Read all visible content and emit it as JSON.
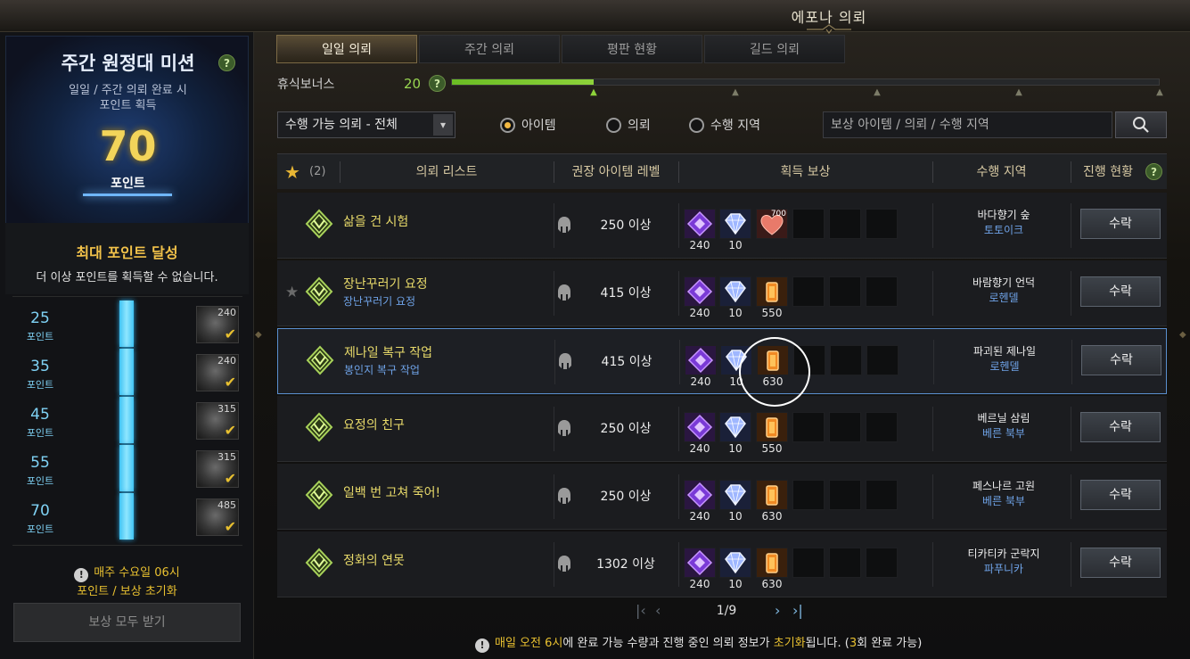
{
  "window": {
    "title": "에포나 의뢰"
  },
  "left": {
    "mission_title": "주간 원정대 미션",
    "mission_help": "?",
    "mission_sub1": "일일 / 주간 의뢰 완료 시",
    "mission_sub2": "포인트 획득",
    "points": "70",
    "points_unit": "포인트",
    "max_title": "최대 포인트 달성",
    "max_desc": "더 이상 포인트를 획득할 수 없습니다.",
    "tiers": [
      {
        "points": "25",
        "unit": "포인트",
        "reward_count": "240",
        "claimed": "✔"
      },
      {
        "points": "35",
        "unit": "포인트",
        "reward_count": "240",
        "claimed": "✔"
      },
      {
        "points": "45",
        "unit": "포인트",
        "reward_count": "315",
        "claimed": "✔"
      },
      {
        "points": "55",
        "unit": "포인트",
        "reward_count": "315",
        "claimed": "✔"
      },
      {
        "points": "70",
        "unit": "포인트",
        "reward_count": "485",
        "claimed": "✔"
      }
    ],
    "reset_line1": "매주 수요일 06시",
    "reset_line2": "포인트 / 보상 초기화",
    "claim_all": "보상 모두 받기"
  },
  "tabs": [
    "일일 의뢰",
    "주간 의뢰",
    "평판 현황",
    "길드 의뢰"
  ],
  "active_tab": 0,
  "rest_bonus": {
    "label": "휴식보너스",
    "value": "20",
    "help": "?",
    "fill_fraction": 0.2
  },
  "filter": {
    "selected": "수행 가능 의뢰 - 전체",
    "arrow": "▾"
  },
  "radios": [
    {
      "label": "아이템",
      "on": true
    },
    {
      "label": "의뢰",
      "on": false
    },
    {
      "label": "수행 지역",
      "on": false
    }
  ],
  "search": {
    "placeholder": "보상 아이템 / 의뢰 / 수행 지역",
    "icon": "search-icon"
  },
  "table": {
    "fav_count": "(2)",
    "headers": [
      "의뢰 리스트",
      "권장 아이템 레벨",
      "획득 보상",
      "수행 지역",
      "진행 현황"
    ],
    "progress_help": "?",
    "rows": [
      {
        "name": "삶을 건 시험",
        "sub": "",
        "favorite": false,
        "level": "250 이상",
        "rewards": [
          {
            "type": "purple",
            "count": "240"
          },
          {
            "type": "crystal",
            "count": "10"
          },
          {
            "type": "heart",
            "count": "",
            "mini": "700"
          }
        ],
        "region": "바다향기 숲",
        "region_sub": "토토이크",
        "action": "수락"
      },
      {
        "name": "장난꾸러기 요정",
        "sub": "장난꾸러기 요정",
        "favorite": true,
        "level": "415 이상",
        "rewards": [
          {
            "type": "purple",
            "count": "240"
          },
          {
            "type": "crystal",
            "count": "10"
          },
          {
            "type": "orange",
            "count": "550"
          }
        ],
        "region": "바람향기 언덕",
        "region_sub": "로헨델",
        "action": "수락"
      },
      {
        "name": "제나일 복구 작업",
        "sub": "봉인지 복구 작업",
        "favorite": false,
        "level": "415 이상",
        "rewards": [
          {
            "type": "purple",
            "count": "240"
          },
          {
            "type": "crystal",
            "count": "10"
          },
          {
            "type": "orange",
            "count": "630"
          }
        ],
        "region": "파괴된 제나일",
        "region_sub": "로헨델",
        "action": "수락"
      },
      {
        "name": "요정의 친구",
        "sub": "",
        "favorite": false,
        "level": "250 이상",
        "rewards": [
          {
            "type": "purple",
            "count": "240"
          },
          {
            "type": "crystal",
            "count": "10"
          },
          {
            "type": "orange",
            "count": "550"
          }
        ],
        "region": "베르닐 삼림",
        "region_sub": "베른 북부",
        "action": "수락"
      },
      {
        "name": "일백 번 고쳐 죽어!",
        "sub": "",
        "favorite": false,
        "level": "250 이상",
        "rewards": [
          {
            "type": "purple",
            "count": "240"
          },
          {
            "type": "crystal",
            "count": "10"
          },
          {
            "type": "orange",
            "count": "630"
          }
        ],
        "region": "페스나르 고원",
        "region_sub": "베른 북부",
        "action": "수락"
      },
      {
        "name": "정화의 연못",
        "sub": "",
        "favorite": false,
        "level": "1302 이상",
        "rewards": [
          {
            "type": "purple",
            "count": "240"
          },
          {
            "type": "crystal",
            "count": "10"
          },
          {
            "type": "orange",
            "count": "630"
          }
        ],
        "region": "티카티카 군락지",
        "region_sub": "파푸니카",
        "action": "수락"
      }
    ]
  },
  "pager": {
    "text": "1/9",
    "first": "|‹",
    "prev": "‹",
    "next": "›",
    "last": "›|"
  },
  "footer": {
    "pre": "매일 오전 6시",
    "mid": "에 완료 가능 수량과 진행 중인 의뢰 정보가 ",
    "hl": "초기화",
    "post1": "됩니다. (",
    "count": "3",
    "post2": "회 완료 가능)"
  },
  "colors": {
    "accent_gold": "#e8c030",
    "quest_name": "#e8da6a",
    "link_blue": "#6fa3e8",
    "rest_green": "#8dd23a",
    "tier_cyan": "#3fc3f3"
  }
}
